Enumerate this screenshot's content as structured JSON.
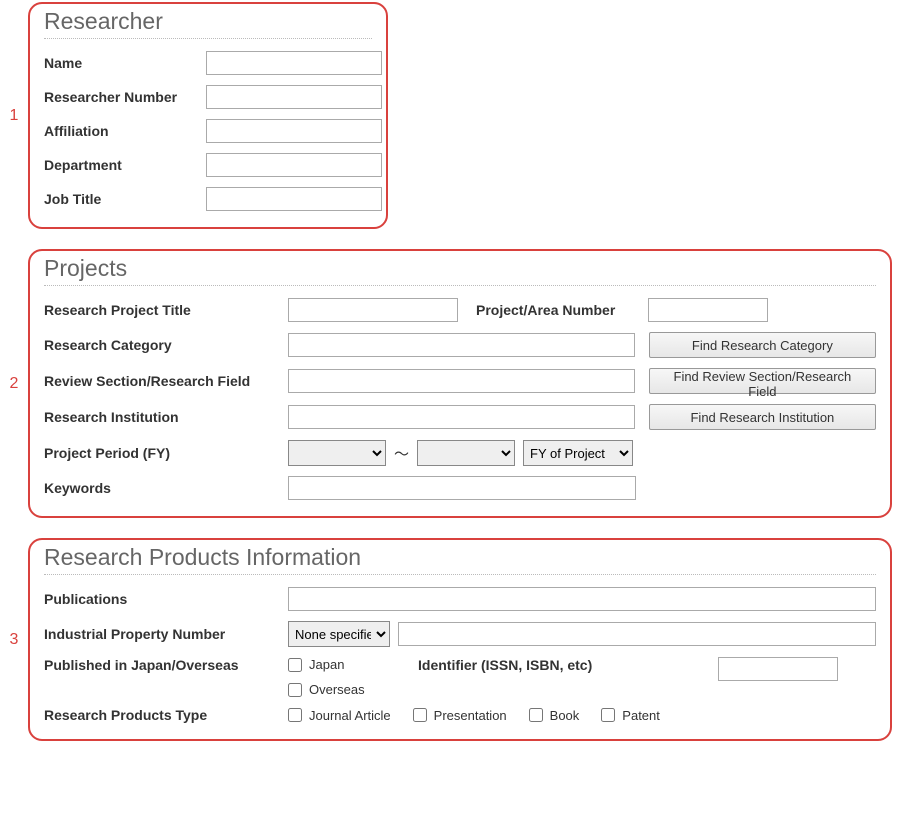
{
  "sections": {
    "researcher": {
      "num": "1",
      "title": "Researcher",
      "fields": {
        "name": "Name",
        "number": "Researcher Number",
        "affiliation": "Affiliation",
        "department": "Department",
        "job_title": "Job Title"
      }
    },
    "projects": {
      "num": "2",
      "title": "Projects",
      "fields": {
        "title": "Research Project Title",
        "pan": "Project/Area Number",
        "category": "Research Category",
        "review": "Review Section/Research Field",
        "institution": "Research Institution",
        "period": "Project Period (FY)",
        "keywords": "Keywords"
      },
      "buttons": {
        "category": "Find Research Category",
        "review": "Find Review Section/Research Field",
        "institution": "Find Research Institution"
      },
      "tilde": "～",
      "fy_select": "FY of Project"
    },
    "products": {
      "num": "3",
      "title": "Research Products Information",
      "fields": {
        "publications": "Publications",
        "ipn": "Industrial Property Number",
        "published_in": "Published in Japan/Overseas",
        "identifier": "Identifier (ISSN, ISBN, etc)",
        "type": "Research Products Type"
      },
      "ipn_select": "None specified",
      "pub_opts": {
        "japan": "Japan",
        "overseas": "Overseas"
      },
      "types": {
        "journal": "Journal Article",
        "presentation": "Presentation",
        "book": "Book",
        "patent": "Patent"
      }
    }
  }
}
